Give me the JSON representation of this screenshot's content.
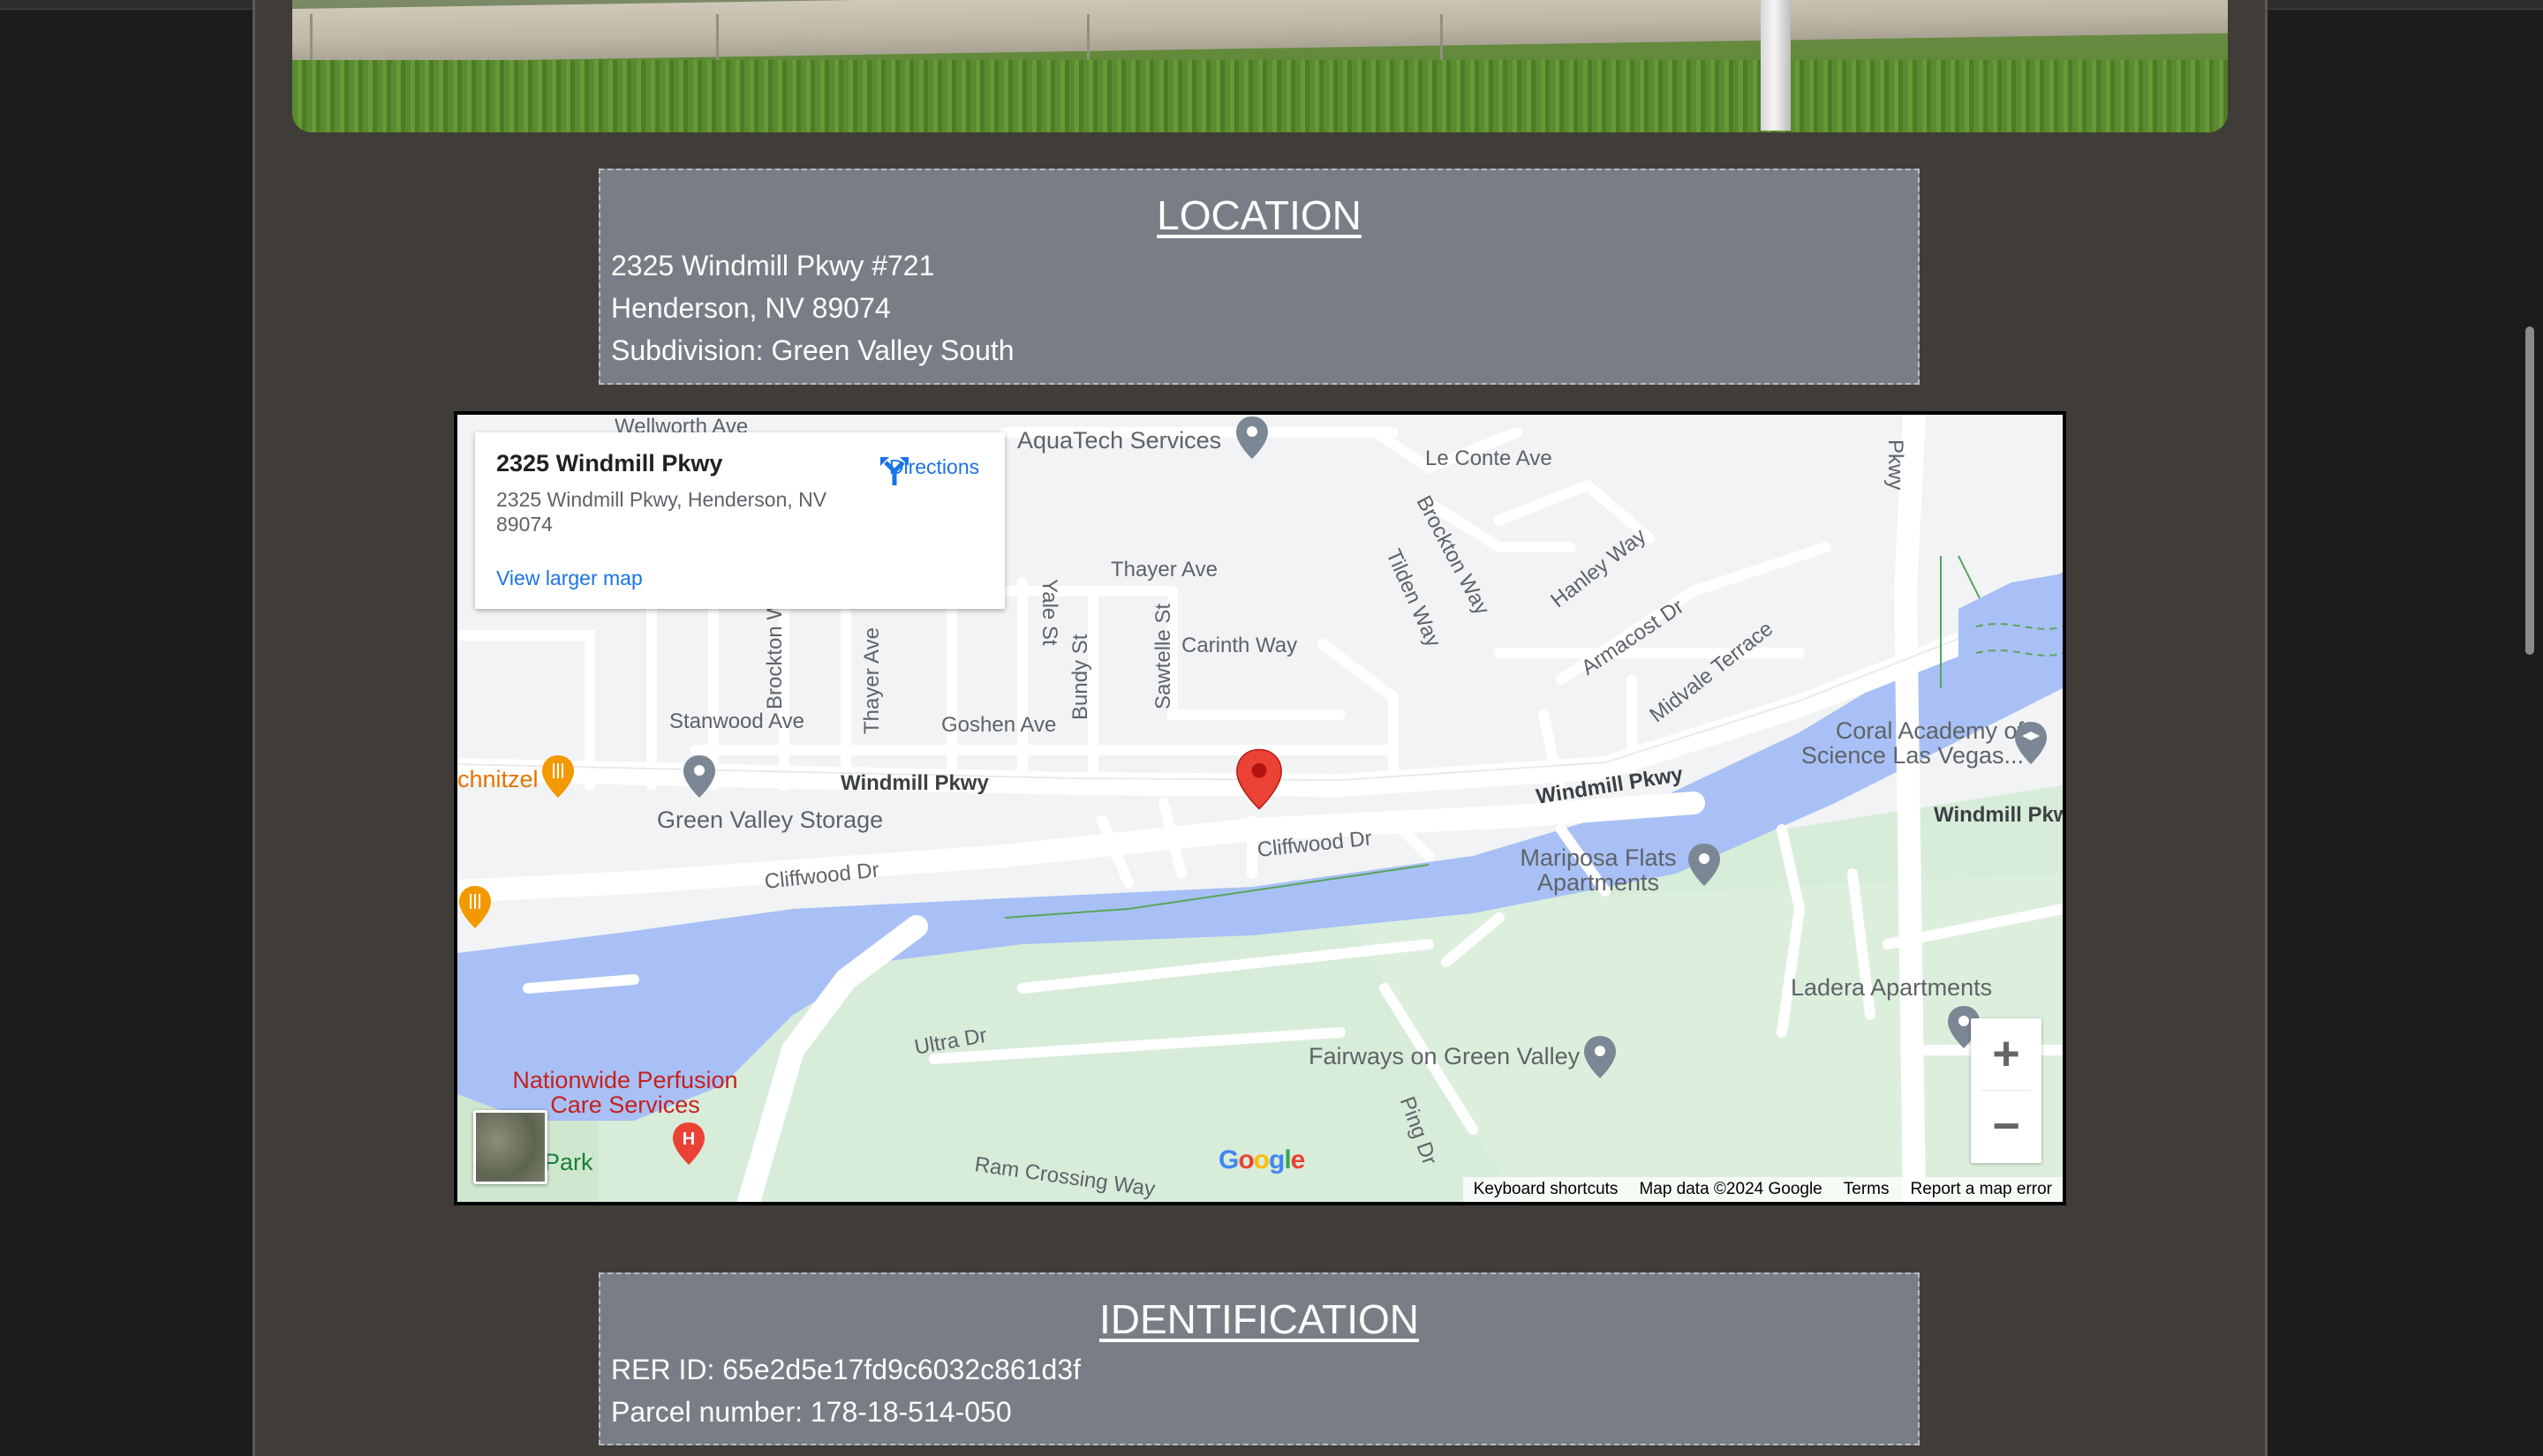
{
  "location": {
    "heading": "LOCATION",
    "address_line1": "2325 Windmill Pkwy #721",
    "address_line2": "Henderson, NV 89074",
    "subdivision": "Subdivision: Green Valley South"
  },
  "map": {
    "card": {
      "title": "2325 Windmill Pkwy",
      "address": "2325 Windmill Pkwy, Henderson, NV 89074",
      "directions": "Directions",
      "view_larger": "View larger map"
    },
    "streets": {
      "wellworth": "Wellworth Ave",
      "le_conte": "Le Conte Ave",
      "brockton_way": "Brockton Way",
      "tilden": "Tilden Way",
      "hanley": "Hanley Way",
      "thayer": "Thayer Ave",
      "thayer_v": "Thayer Ave",
      "yale": "Yale St",
      "carinth": "Carinth Way",
      "armacost": "Armacost Dr",
      "midvale": "Midvale Terrace",
      "stanwood": "Stanwood Ave",
      "goshen": "Goshen Ave",
      "bundy": "Bundy St",
      "sawtelle": "Sawtelle St",
      "brockton_v": "Brockton W",
      "windmill_w": "Windmill Pkwy",
      "windmill_mid": "Windmill Pkwy",
      "windmill_e": "Windmill Pkwy",
      "cliffwood_w": "Cliffwood Dr",
      "cliffwood_e": "Cliffwood Dr",
      "ultra": "Ultra Dr",
      "ram_crossing": "Ram Crossing Way",
      "ping": "Ping Dr",
      "pkwy_v": "Pkwy"
    },
    "pois": {
      "aquatech": "AquaTech Services",
      "schnitzel": "chnitzel",
      "storage": "Green Valley Storage",
      "coral": "Coral Academy of Science Las Vegas...",
      "mariposa": "Mariposa Flats Apartments",
      "ladera": "Ladera Apartments",
      "fairways": "Fairways on Green Valley",
      "perfusion": "Nationwide Perfusion Care Services",
      "park": "Park"
    },
    "zoom_in": "+",
    "zoom_out": "−",
    "google_logo": "Google",
    "attribution": {
      "shortcuts": "Keyboard shortcuts",
      "data": "Map data ©2024 Google",
      "terms": "Terms",
      "report": "Report a map error"
    },
    "colors": {
      "water": "#a8c0f5",
      "park": "#d7ecd9",
      "pin": "#ea4335",
      "link": "#1a73e8"
    }
  },
  "identification": {
    "heading": "IDENTIFICATION",
    "rer_id": "RER ID: 65e2d5e17fd9c6032c861d3f",
    "parcel": "Parcel number: 178-18-514-050"
  }
}
